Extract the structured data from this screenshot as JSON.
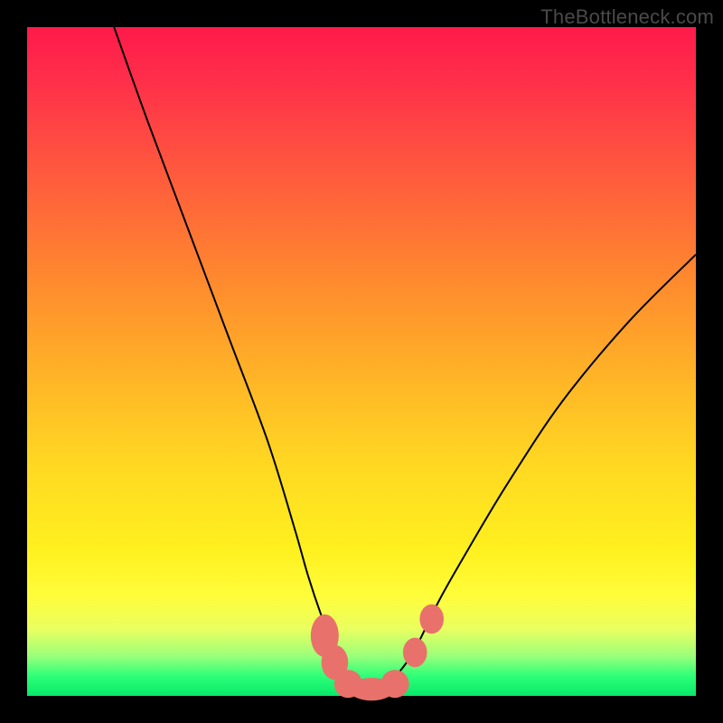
{
  "watermark": "TheBottleneck.com",
  "chart_data": {
    "type": "line",
    "title": "",
    "xlabel": "",
    "ylabel": "",
    "xlim": [
      0,
      100
    ],
    "ylim": [
      0,
      100
    ],
    "grid": false,
    "legend": false,
    "series": [
      {
        "name": "curve",
        "x": [
          13,
          18,
          24,
          30,
          36,
          40,
          42,
          44,
          46,
          47,
          48,
          50,
          52,
          54,
          56,
          58,
          60,
          62,
          66,
          72,
          80,
          90,
          100
        ],
        "y": [
          100,
          86,
          70,
          54,
          38,
          25,
          18,
          12,
          7,
          4,
          2,
          1,
          1,
          2,
          4,
          7,
          11,
          15,
          22,
          32,
          44,
          56,
          66
        ]
      }
    ],
    "markers": {
      "name": "highlight-points",
      "color": "#e9716b",
      "points": [
        {
          "x": 44.5,
          "y": 9,
          "rx": 2.1,
          "ry": 3.2
        },
        {
          "x": 46.0,
          "y": 5,
          "rx": 2.0,
          "ry": 2.6
        },
        {
          "x": 48.0,
          "y": 1.8,
          "rx": 2.1,
          "ry": 2.1
        },
        {
          "x": 51.5,
          "y": 1.0,
          "rx": 3.4,
          "ry": 1.7
        },
        {
          "x": 55.0,
          "y": 1.8,
          "rx": 2.1,
          "ry": 2.1
        },
        {
          "x": 58.0,
          "y": 6.5,
          "rx": 1.8,
          "ry": 2.2
        },
        {
          "x": 60.5,
          "y": 11.5,
          "rx": 1.8,
          "ry": 2.2
        }
      ]
    },
    "background_gradient": {
      "top": "#ff1a4a",
      "mid": "#ffd722",
      "bottom": "#08e86a"
    }
  }
}
